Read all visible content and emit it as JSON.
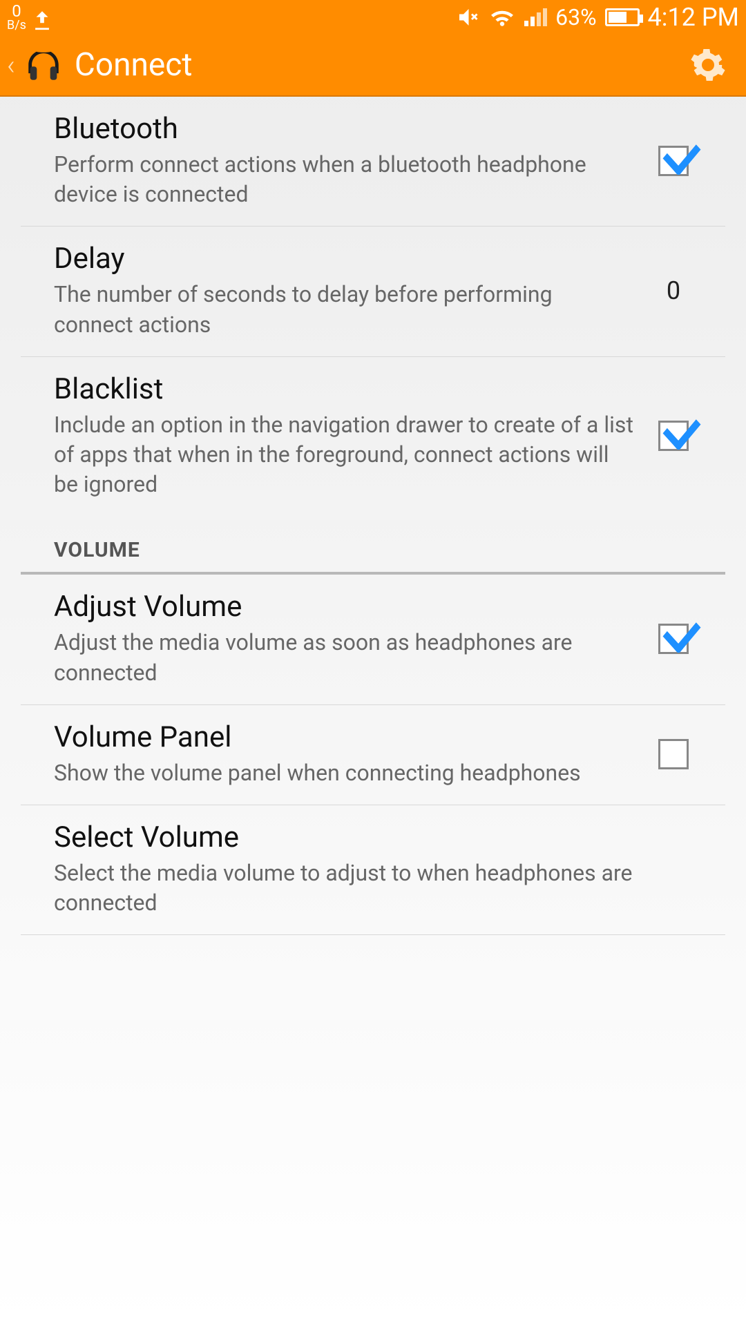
{
  "status": {
    "speed_value": "0",
    "speed_unit": "B/s",
    "upload_icon": "upload-icon",
    "mute_icon": "volume-mute-icon",
    "wifi_icon": "wifi-icon",
    "signal_bars_active": 2,
    "battery_percent": "63%",
    "time": "4:12 PM"
  },
  "appbar": {
    "back_icon": "chevron-left-icon",
    "app_icon": "headphones-icon",
    "title": "Connect",
    "settings_icon": "gear-icon"
  },
  "settings": [
    {
      "key": "bluetooth",
      "title": "Bluetooth",
      "desc": "Perform connect actions when a bluetooth headphone device is connected",
      "type": "checkbox",
      "checked": true
    },
    {
      "key": "delay",
      "title": "Delay",
      "desc": "The number of seconds to delay before performing connect actions",
      "type": "value",
      "value": "0"
    },
    {
      "key": "blacklist",
      "title": "Blacklist",
      "desc": "Include an option in the navigation drawer to create of a list of apps that when in the foreground, connect actions will be ignored",
      "type": "checkbox",
      "checked": true
    }
  ],
  "volume_header": "VOLUME",
  "volume_settings": [
    {
      "key": "adjust_volume",
      "title": "Adjust Volume",
      "desc": "Adjust the media volume as soon as headphones are connected",
      "type": "checkbox",
      "checked": true
    },
    {
      "key": "volume_panel",
      "title": "Volume Panel",
      "desc": "Show the volume panel when connecting headphones",
      "type": "checkbox",
      "checked": false
    },
    {
      "key": "select_volume",
      "title": "Select Volume",
      "desc": "Select the media volume to adjust to when headphones are connected",
      "type": "none"
    }
  ],
  "colors": {
    "accent": "#ff8c00",
    "check": "#1e90ff"
  }
}
